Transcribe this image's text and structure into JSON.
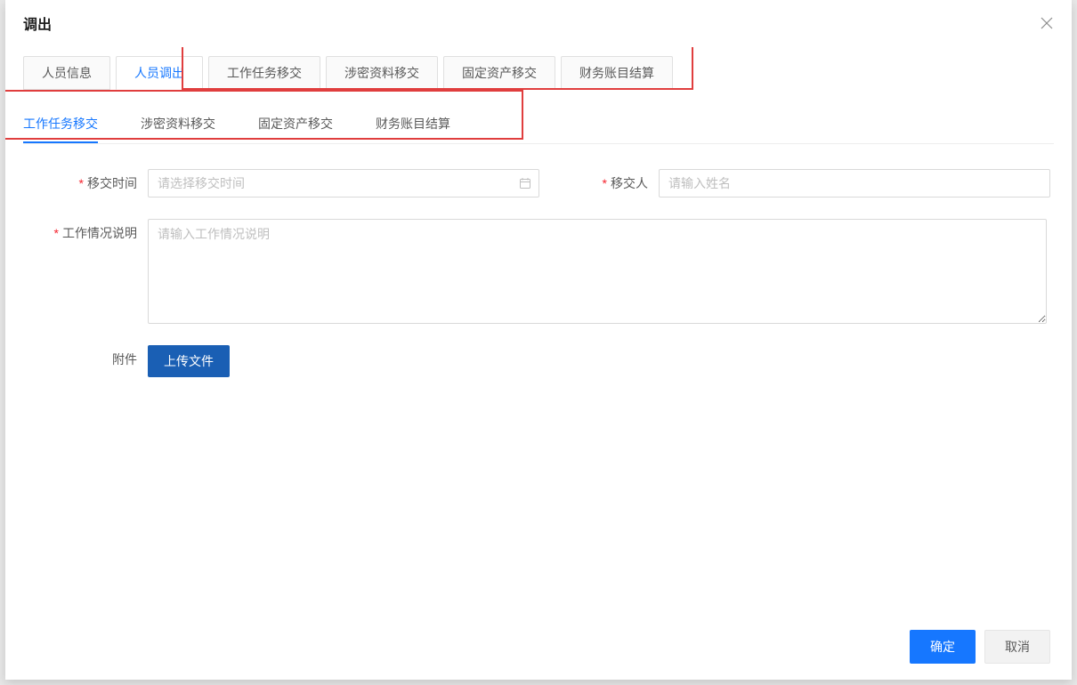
{
  "modal": {
    "title": "调出"
  },
  "primaryTabs": {
    "items": [
      {
        "label": "人员信息"
      },
      {
        "label": "人员调出"
      },
      {
        "label": "工作任务移交"
      },
      {
        "label": "涉密资料移交"
      },
      {
        "label": "固定资产移交"
      },
      {
        "label": "财务账目结算"
      }
    ]
  },
  "subTabs": {
    "items": [
      {
        "label": "工作任务移交"
      },
      {
        "label": "涉密资料移交"
      },
      {
        "label": "固定资产移交"
      },
      {
        "label": "财务账目结算"
      }
    ]
  },
  "form": {
    "transferTime": {
      "label": "移交时间",
      "placeholder": "请选择移交时间"
    },
    "transferPerson": {
      "label": "移交人",
      "placeholder": "请输入姓名"
    },
    "workDescription": {
      "label": "工作情况说明",
      "placeholder": "请输入工作情况说明"
    },
    "attachment": {
      "label": "附件",
      "buttonLabel": "上传文件"
    }
  },
  "footer": {
    "confirm": "确定",
    "cancel": "取消"
  }
}
